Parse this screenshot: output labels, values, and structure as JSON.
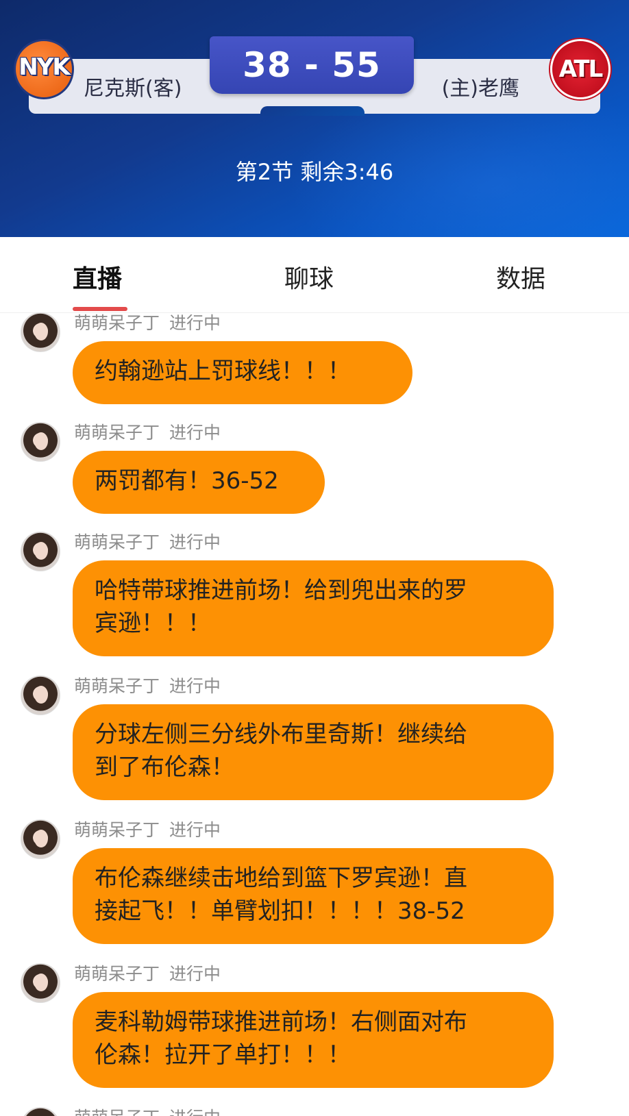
{
  "colors": {
    "header_bg": "#123a8e",
    "score_box": "#3f4fc0",
    "bubble": "#fd9104",
    "tab_indicator": "#e34b4b",
    "meta_text": "#8c8c8c"
  },
  "game": {
    "away_logo_text": "NYK",
    "away_name": "尼克斯(客)",
    "score": "38 - 55",
    "home_name": "(主)老鹰",
    "home_logo_text": "ATL",
    "period": "第2节 剩余3:46"
  },
  "tabs": [
    {
      "label": "直播",
      "active": true
    },
    {
      "label": "聊球",
      "active": false
    },
    {
      "label": "数据",
      "active": false
    }
  ],
  "posts": [
    {
      "author": "萌萌呆子丁",
      "status": "进行中",
      "text": "约翰逊站上罚球线！！！"
    },
    {
      "author": "萌萌呆子丁",
      "status": "进行中",
      "text": "两罚都有！36-52"
    },
    {
      "author": "萌萌呆子丁",
      "status": "进行中",
      "line1": "哈特带球推进前场！给到兜出来的罗",
      "line2": "宾逊！！！"
    },
    {
      "author": "萌萌呆子丁",
      "status": "进行中",
      "line1": "分球左侧三分线外布里奇斯！继续给",
      "line2": "到了布伦森！"
    },
    {
      "author": "萌萌呆子丁",
      "status": "进行中",
      "line1": "布伦森继续击地给到篮下罗宾逊！直",
      "line2": "接起飞！！单臂划扣！！！！38-52"
    },
    {
      "author": "萌萌呆子丁",
      "status": "进行中",
      "line1": "麦科勒姆带球推进前场！右侧面对布",
      "line2": "伦森！拉开了单打！！！"
    },
    {
      "author": "萌萌呆子丁",
      "status": "进行中"
    }
  ]
}
